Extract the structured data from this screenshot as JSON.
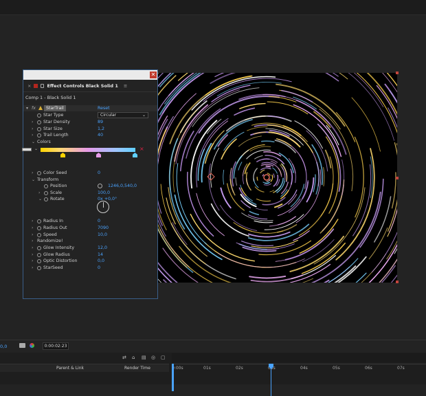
{
  "effect_panel": {
    "tab_title": "Effect Controls Black Solid 1",
    "comp_label": "Comp 1 - Black Solid 1",
    "effect": {
      "badge": "fx",
      "name": "StarTrail",
      "reset_label": "Reset"
    },
    "star_type": {
      "label": "Star Type",
      "value": "Circular"
    },
    "star_density": {
      "label": "Star Density",
      "value": "89"
    },
    "star_size": {
      "label": "Star Size",
      "value": "1,2"
    },
    "trail_length": {
      "label": "Trail Length",
      "value": "40"
    },
    "colors": {
      "label": "Colors"
    },
    "color_seed": {
      "label": "Color Seed",
      "value": "0"
    },
    "transform": {
      "label": "Transform"
    },
    "position": {
      "label": "Position",
      "value": "1246,0,540,0"
    },
    "scale": {
      "label": "Scale",
      "value": "100,0"
    },
    "rotate": {
      "label": "Rotate",
      "value": "0x +0,0°"
    },
    "radius_in": {
      "label": "Radius In",
      "value": "0"
    },
    "radius_out": {
      "label": "Radius Out",
      "value": "7090"
    },
    "speed": {
      "label": "Speed",
      "value": "10,0"
    },
    "randomize": {
      "label": "Randomize!"
    },
    "glow_intensity": {
      "label": "Glow Intensity",
      "value": "12,0"
    },
    "glow_radius": {
      "label": "Glow Radius",
      "value": "14"
    },
    "optic_distortion": {
      "label": "Optic Distortion",
      "value": "0,0"
    },
    "star_seed": {
      "label": "StarSeed",
      "value": "0"
    },
    "gradient_stops": [
      "#ffd400",
      "#e69ae8",
      "#5fd0ff"
    ]
  },
  "bottom": {
    "timecode_left": "0,0",
    "current_time": "0:00:02:23"
  },
  "timeline": {
    "col_parent": "Parent & Link",
    "col_render": "Render Time",
    "ruler": [
      "0:00s",
      "01s",
      "02s",
      "03s",
      "04s",
      "05s",
      "06s",
      "07s"
    ]
  },
  "colors": {
    "accent": "#4aa3ff",
    "panel_bg": "#232323",
    "canvas_bg": "#000000"
  }
}
